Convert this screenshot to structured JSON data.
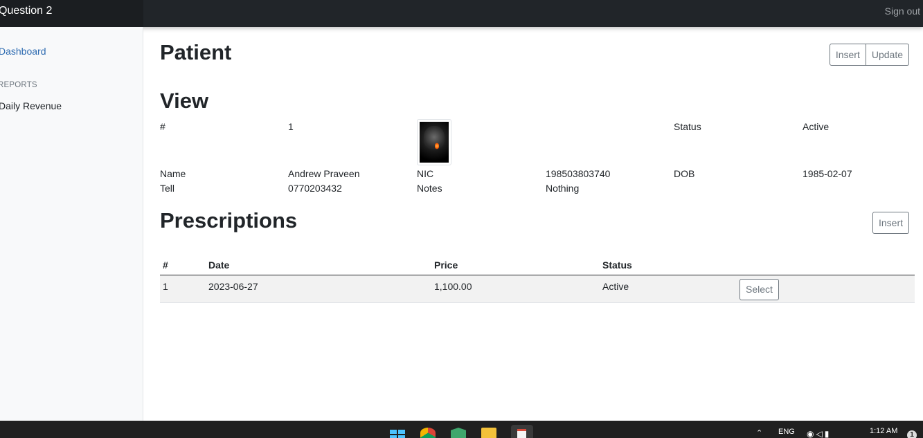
{
  "navbar": {
    "brand": "Question 2",
    "signout": "Sign out"
  },
  "sidebar": {
    "dashboard": "Dashboard",
    "reports_heading": "REPORTS",
    "daily_revenue": "Daily Revenue"
  },
  "page": {
    "title": "Patient",
    "insert_label": "Insert",
    "update_label": "Update",
    "view_heading": "View"
  },
  "patient": {
    "id_label": "#",
    "id_value": "1",
    "status_label": "Status",
    "status_value": "Active",
    "name_label": "Name",
    "name_value": "Andrew Praveen",
    "nic_label": "NIC",
    "nic_value": "198503803740",
    "dob_label": "DOB",
    "dob_value": "1985-02-07",
    "tell_label": "Tell",
    "tell_value": "0770203432",
    "notes_label": "Notes",
    "notes_value": "Nothing"
  },
  "prescriptions": {
    "heading": "Prescriptions",
    "insert_label": "Insert",
    "columns": [
      "#",
      "Date",
      "Price",
      "Status"
    ],
    "rows": [
      {
        "id": "1",
        "date": "2023-06-27",
        "price": "1,100.00",
        "status": "Active",
        "action": "Select"
      }
    ]
  },
  "taskbar": {
    "lang": "ENG",
    "time": "1:12 AM",
    "icons": [
      "windows-start-icon",
      "chrome-icon",
      "app-cube-icon",
      "file-explorer-icon",
      "notepad-icon"
    ]
  }
}
